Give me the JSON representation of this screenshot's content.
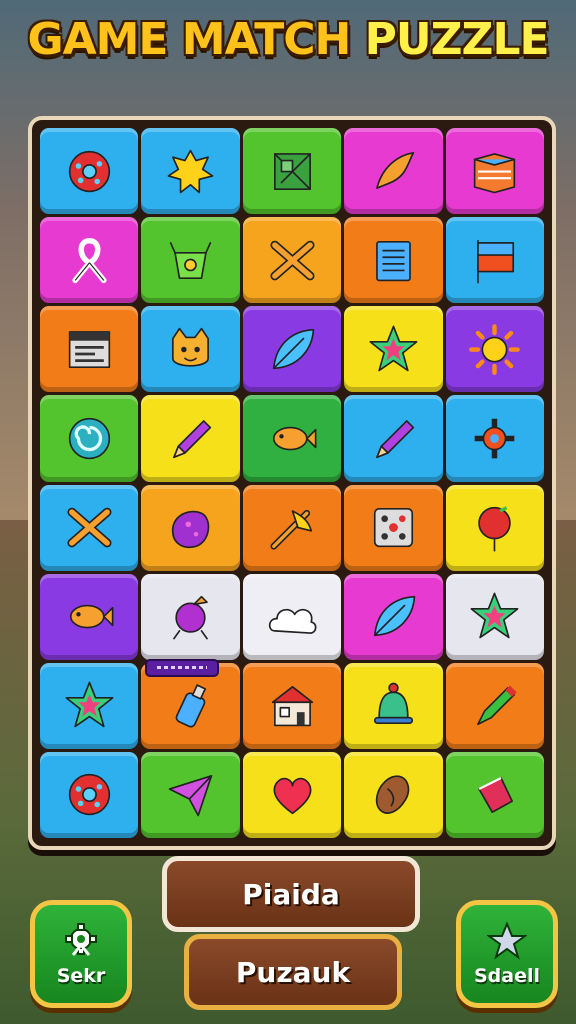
{
  "title": {
    "part1": "GAME MATCH ",
    "part2": "PUZZLE"
  },
  "buttons": {
    "primary_label": "Piaida",
    "secondary_label": "Puzauk",
    "left_label": "Sekr",
    "right_label": "Sdaell"
  },
  "board": {
    "cols": 5,
    "rows": [
      [
        {
          "color": "#2fb0ee",
          "icon": "donut-icon"
        },
        {
          "color": "#2fb0ee",
          "icon": "splat-icon"
        },
        {
          "color": "#53c42e",
          "icon": "cube-icon"
        },
        {
          "color": "#e63ad0",
          "icon": "feather-icon"
        },
        {
          "color": "#e63ad0",
          "icon": "box-icon"
        }
      ],
      [
        {
          "color": "#e63ad0",
          "icon": "ribbon-icon"
        },
        {
          "color": "#53c42e",
          "icon": "pot-icon"
        },
        {
          "color": "#f6a41e",
          "icon": "cross-tools-icon"
        },
        {
          "color": "#f27d18",
          "icon": "notepad-icon"
        },
        {
          "color": "#2fb0ee",
          "icon": "flag-icon"
        }
      ],
      [
        {
          "color": "#f27d18",
          "icon": "window-icon"
        },
        {
          "color": "#2fb0ee",
          "icon": "cat-face-icon"
        },
        {
          "color": "#8a3ae2",
          "icon": "leaf-icon"
        },
        {
          "color": "#f6e01a",
          "icon": "star-icon"
        },
        {
          "color": "#8a3ae2",
          "icon": "sun-icon"
        }
      ],
      [
        {
          "color": "#53c42e",
          "icon": "swirl-icon"
        },
        {
          "color": "#f6e01a",
          "icon": "pencil-icon"
        },
        {
          "color": "#30b040",
          "icon": "fish-icon"
        },
        {
          "color": "#2fb0ee",
          "icon": "pencil-icon"
        },
        {
          "color": "#2fb0ee",
          "icon": "gear-icon"
        }
      ],
      [
        {
          "color": "#2fb0ee",
          "icon": "cross-tools-icon"
        },
        {
          "color": "#f6a41e",
          "icon": "rock-icon"
        },
        {
          "color": "#f27d18",
          "icon": "crossbow-icon"
        },
        {
          "color": "#f27d18",
          "icon": "dice-icon"
        },
        {
          "color": "#f6e01a",
          "icon": "balloon-icon"
        }
      ],
      [
        {
          "color": "#8a3ae2",
          "icon": "fish-icon"
        },
        {
          "color": "#e6e6ee",
          "icon": "berry-icon"
        },
        {
          "color": "#eeeef4",
          "icon": "cloud-icon"
        },
        {
          "color": "#e63ad0",
          "icon": "leaf-icon"
        },
        {
          "color": "#e6e6ee",
          "icon": "star-icon"
        }
      ],
      [
        {
          "color": "#2fb0ee",
          "icon": "star-icon"
        },
        {
          "color": "#f27d18",
          "icon": "bottle-icon"
        },
        {
          "color": "#f27d18",
          "icon": "house-icon"
        },
        {
          "color": "#f6e01a",
          "icon": "bell-icon"
        },
        {
          "color": "#f27d18",
          "icon": "marker-icon"
        }
      ],
      [
        {
          "color": "#2fb0ee",
          "icon": "donut-icon"
        },
        {
          "color": "#53c42e",
          "icon": "plane-icon"
        },
        {
          "color": "#f6e01a",
          "icon": "heart-icon"
        },
        {
          "color": "#f6e01a",
          "icon": "bean-icon"
        },
        {
          "color": "#53c42e",
          "icon": "cup-icon"
        }
      ]
    ]
  },
  "icons": {
    "left_button": "gear-icon",
    "right_button": "star-icon"
  }
}
